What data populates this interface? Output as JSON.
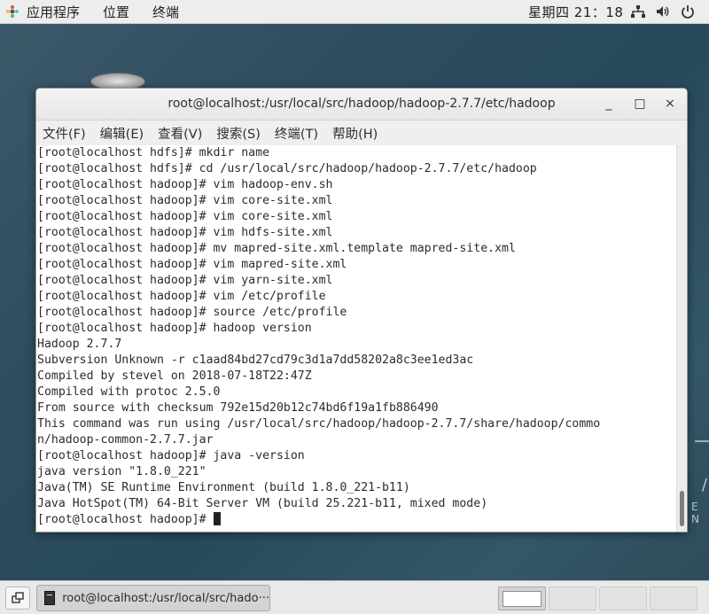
{
  "topbar": {
    "applications": "应用程序",
    "places": "位置",
    "terminal_app": "终端",
    "clock": "星期四 21：18"
  },
  "window": {
    "title": "root@localhost:/usr/local/src/hadoop/hadoop-2.7.7/etc/hadoop",
    "minimize": "_",
    "maximize": "□",
    "close": "×"
  },
  "menu": {
    "file": "文件(F)",
    "edit": "编辑(E)",
    "view": "查看(V)",
    "search": "搜索(S)",
    "terminal": "终端(T)",
    "help": "帮助(H)"
  },
  "terminal": {
    "lines": [
      "[root@localhost hdfs]# mkdir name",
      "[root@localhost hdfs]# cd /usr/local/src/hadoop/hadoop-2.7.7/etc/hadoop",
      "[root@localhost hadoop]# vim hadoop-env.sh",
      "[root@localhost hadoop]# vim core-site.xml",
      "[root@localhost hadoop]# vim core-site.xml",
      "[root@localhost hadoop]# vim hdfs-site.xml",
      "[root@localhost hadoop]# mv mapred-site.xml.template mapred-site.xml",
      "[root@localhost hadoop]# vim mapred-site.xml",
      "[root@localhost hadoop]# vim yarn-site.xml",
      "[root@localhost hadoop]# vim /etc/profile",
      "[root@localhost hadoop]# source /etc/profile",
      "[root@localhost hadoop]# hadoop version",
      "Hadoop 2.7.7",
      "Subversion Unknown -r c1aad84bd27cd79c3d1a7dd58202a8c3ee1ed3ac",
      "Compiled by stevel on 2018-07-18T22:47Z",
      "Compiled with protoc 2.5.0",
      "From source with checksum 792e15d20b12c74bd6f19a1fb886490",
      "This command was run using /usr/local/src/hadoop/hadoop-2.7.7/share/hadoop/commo",
      "n/hadoop-common-2.7.7.jar",
      "[root@localhost hadoop]# java -version",
      "java version \"1.8.0_221\"",
      "Java(TM) SE Runtime Environment (build 1.8.0_221-b11)",
      "Java HotSpot(TM) 64-Bit Server VM (build 25.221-b11, mixed mode)"
    ],
    "prompt": "[root@localhost hadoop]# "
  },
  "taskbar": {
    "task_label": "root@localhost:/usr/local/src/hado···"
  },
  "side_text": "E N"
}
